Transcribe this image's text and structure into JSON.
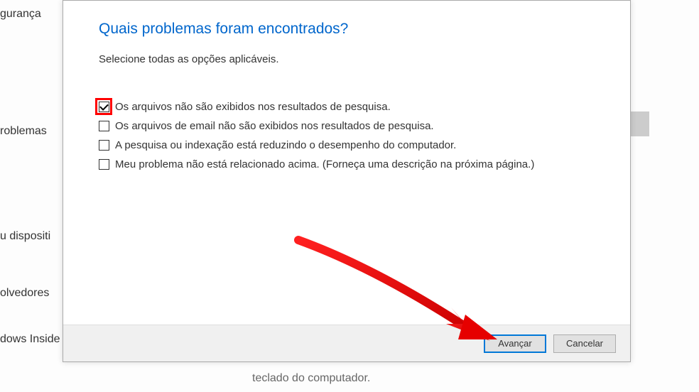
{
  "sidebar": {
    "items": [
      "gurança",
      "roblemas",
      "u dispositi",
      "olvedores",
      "dows Inside"
    ]
  },
  "dialog": {
    "title": "Quais problemas foram encontrados?",
    "subtitle": "Selecione todas as opções aplicáveis.",
    "options": [
      {
        "label": "Os arquivos não são exibidos nos resultados de pesquisa.",
        "checked": true,
        "highlighted": true
      },
      {
        "label": "Os arquivos de email não são exibidos nos resultados de pesquisa.",
        "checked": false,
        "highlighted": false
      },
      {
        "label": "A pesquisa ou indexação está reduzindo o desempenho do computador.",
        "checked": false,
        "highlighted": false
      },
      {
        "label": "Meu problema não está relacionado acima. (Forneça uma descrição na próxima página.)",
        "checked": false,
        "highlighted": false
      }
    ],
    "buttons": {
      "next": "Avançar",
      "cancel": "Cancelar"
    }
  },
  "background": {
    "bottom_text": "teclado do computador."
  }
}
